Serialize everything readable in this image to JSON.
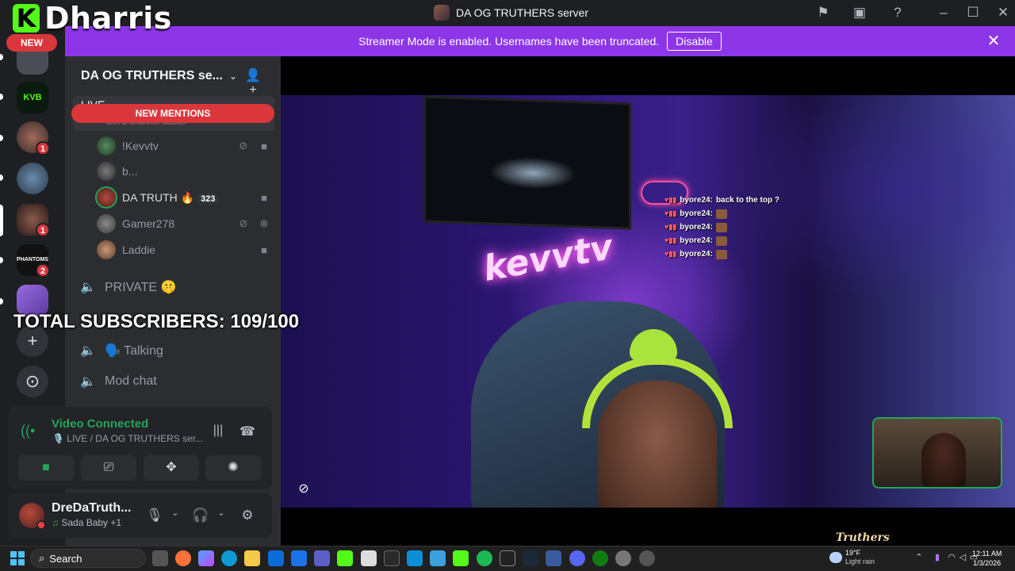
{
  "brand": {
    "logo_letter": "K",
    "name": "Dharris",
    "new_badge": "NEW",
    "color": "#53fc18"
  },
  "window": {
    "title": "DA OG TRUTHERS server"
  },
  "banner": {
    "message": "Streamer Mode is enabled. Usernames have been truncated.",
    "button": "Disable",
    "color": "#8d36e8"
  },
  "rail": {
    "servers": [
      {
        "name": "server-1",
        "badge": ""
      },
      {
        "name": "server-kvb",
        "label": "KVB",
        "badge": ""
      },
      {
        "name": "server-3",
        "badge": "1"
      },
      {
        "name": "server-4",
        "badge": ""
      },
      {
        "name": "server-5",
        "badge": "1"
      },
      {
        "name": "server-phantoms",
        "label": "PHANTOMS",
        "badge": "2"
      },
      {
        "name": "server-7",
        "badge": ""
      }
    ],
    "add_server": "+",
    "discover": "⊙"
  },
  "sidebar": {
    "server_name": "DA OG TRUTHERS se...",
    "new_mentions": "NEW MENTIONS",
    "live_channel": {
      "name": "LIVE",
      "status": "Set a channel status"
    },
    "voice_users": [
      {
        "name": "!Kevvtv",
        "active": false
      },
      {
        "name": "b...",
        "active": false
      },
      {
        "name": "DA TRUTH",
        "live_count": "323",
        "active": true
      },
      {
        "name": "Gamer278",
        "active": false
      },
      {
        "name": "Laddie",
        "active": false
      }
    ],
    "channels": [
      {
        "name": "PRIVATE 🤫"
      },
      {
        "name": "🗣️ Talking"
      },
      {
        "name": "Mod chat"
      }
    ]
  },
  "overlay": {
    "subscribers": "TOTAL SUBSCRIBERS: 109/100"
  },
  "voice": {
    "status": "Video Connected",
    "channel": "🎙️ LIVE / DA OG TRUTHERS ser..."
  },
  "user": {
    "name": "DreDaTruth...",
    "activity_icon": "♫",
    "activity": "Sada Baby",
    "activity_extra": "+1"
  },
  "stream": {
    "neon_sign": "kevvtv",
    "chat": [
      {
        "user": "byore24:",
        "message": "back to the top ?"
      },
      {
        "user": "byore24:",
        "message": ""
      },
      {
        "user": "byore24:",
        "message": ""
      },
      {
        "user": "byore24:",
        "message": ""
      },
      {
        "user": "byore24:",
        "message": ""
      }
    ]
  },
  "watermark": "Truthers",
  "taskbar": {
    "search": "Search",
    "weather_temp": "19°F",
    "weather_desc": "Light rain",
    "time": "12:11 AM",
    "date": "1/3/2026"
  }
}
